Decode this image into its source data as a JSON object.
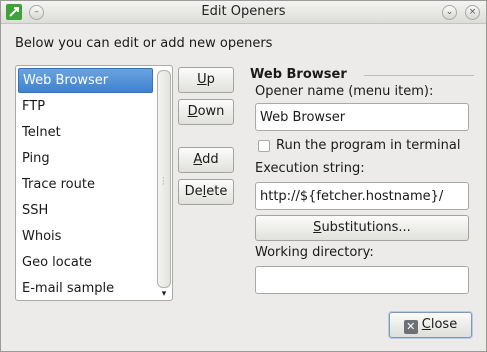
{
  "window": {
    "title": "Edit Openers"
  },
  "intro_text": "Below you can edit or add new openers",
  "openers": [
    {
      "label": "Web Browser",
      "selected": true
    },
    {
      "label": "FTP"
    },
    {
      "label": "Telnet"
    },
    {
      "label": "Ping"
    },
    {
      "label": "Trace route"
    },
    {
      "label": "SSH"
    },
    {
      "label": "Whois"
    },
    {
      "label": "Geo locate"
    },
    {
      "label": "E-mail sample"
    }
  ],
  "buttons": {
    "up": {
      "label": "Up",
      "mnemonic": "U"
    },
    "down": {
      "label": "Down",
      "mnemonic": "D"
    },
    "add": {
      "label": "Add",
      "mnemonic": "A"
    },
    "delete": {
      "label": "Delete",
      "mnemonic": "l"
    },
    "substitutions": {
      "label": "Substitutions...",
      "mnemonic": "S"
    },
    "close": {
      "label": "Close",
      "mnemonic": "C"
    }
  },
  "editor": {
    "group_title": "Web Browser",
    "name_label": "Opener name (menu item):",
    "name_value": "Web Browser",
    "terminal_label": "Run the program in terminal",
    "terminal_checked": false,
    "exec_label": "Execution string:",
    "exec_value": "http://${fetcher.hostname}/",
    "workdir_label": "Working directory:",
    "workdir_value": ""
  },
  "icons": {
    "app": "app-icon",
    "menu": "window-menu-icon",
    "minimize": "minimize-icon",
    "close": "window-close-icon",
    "close_button": "close-x-icon"
  },
  "colors": {
    "selection": "#3f82cf",
    "window_bg": "#ecebe9",
    "app_icon": "#3ea13a"
  }
}
